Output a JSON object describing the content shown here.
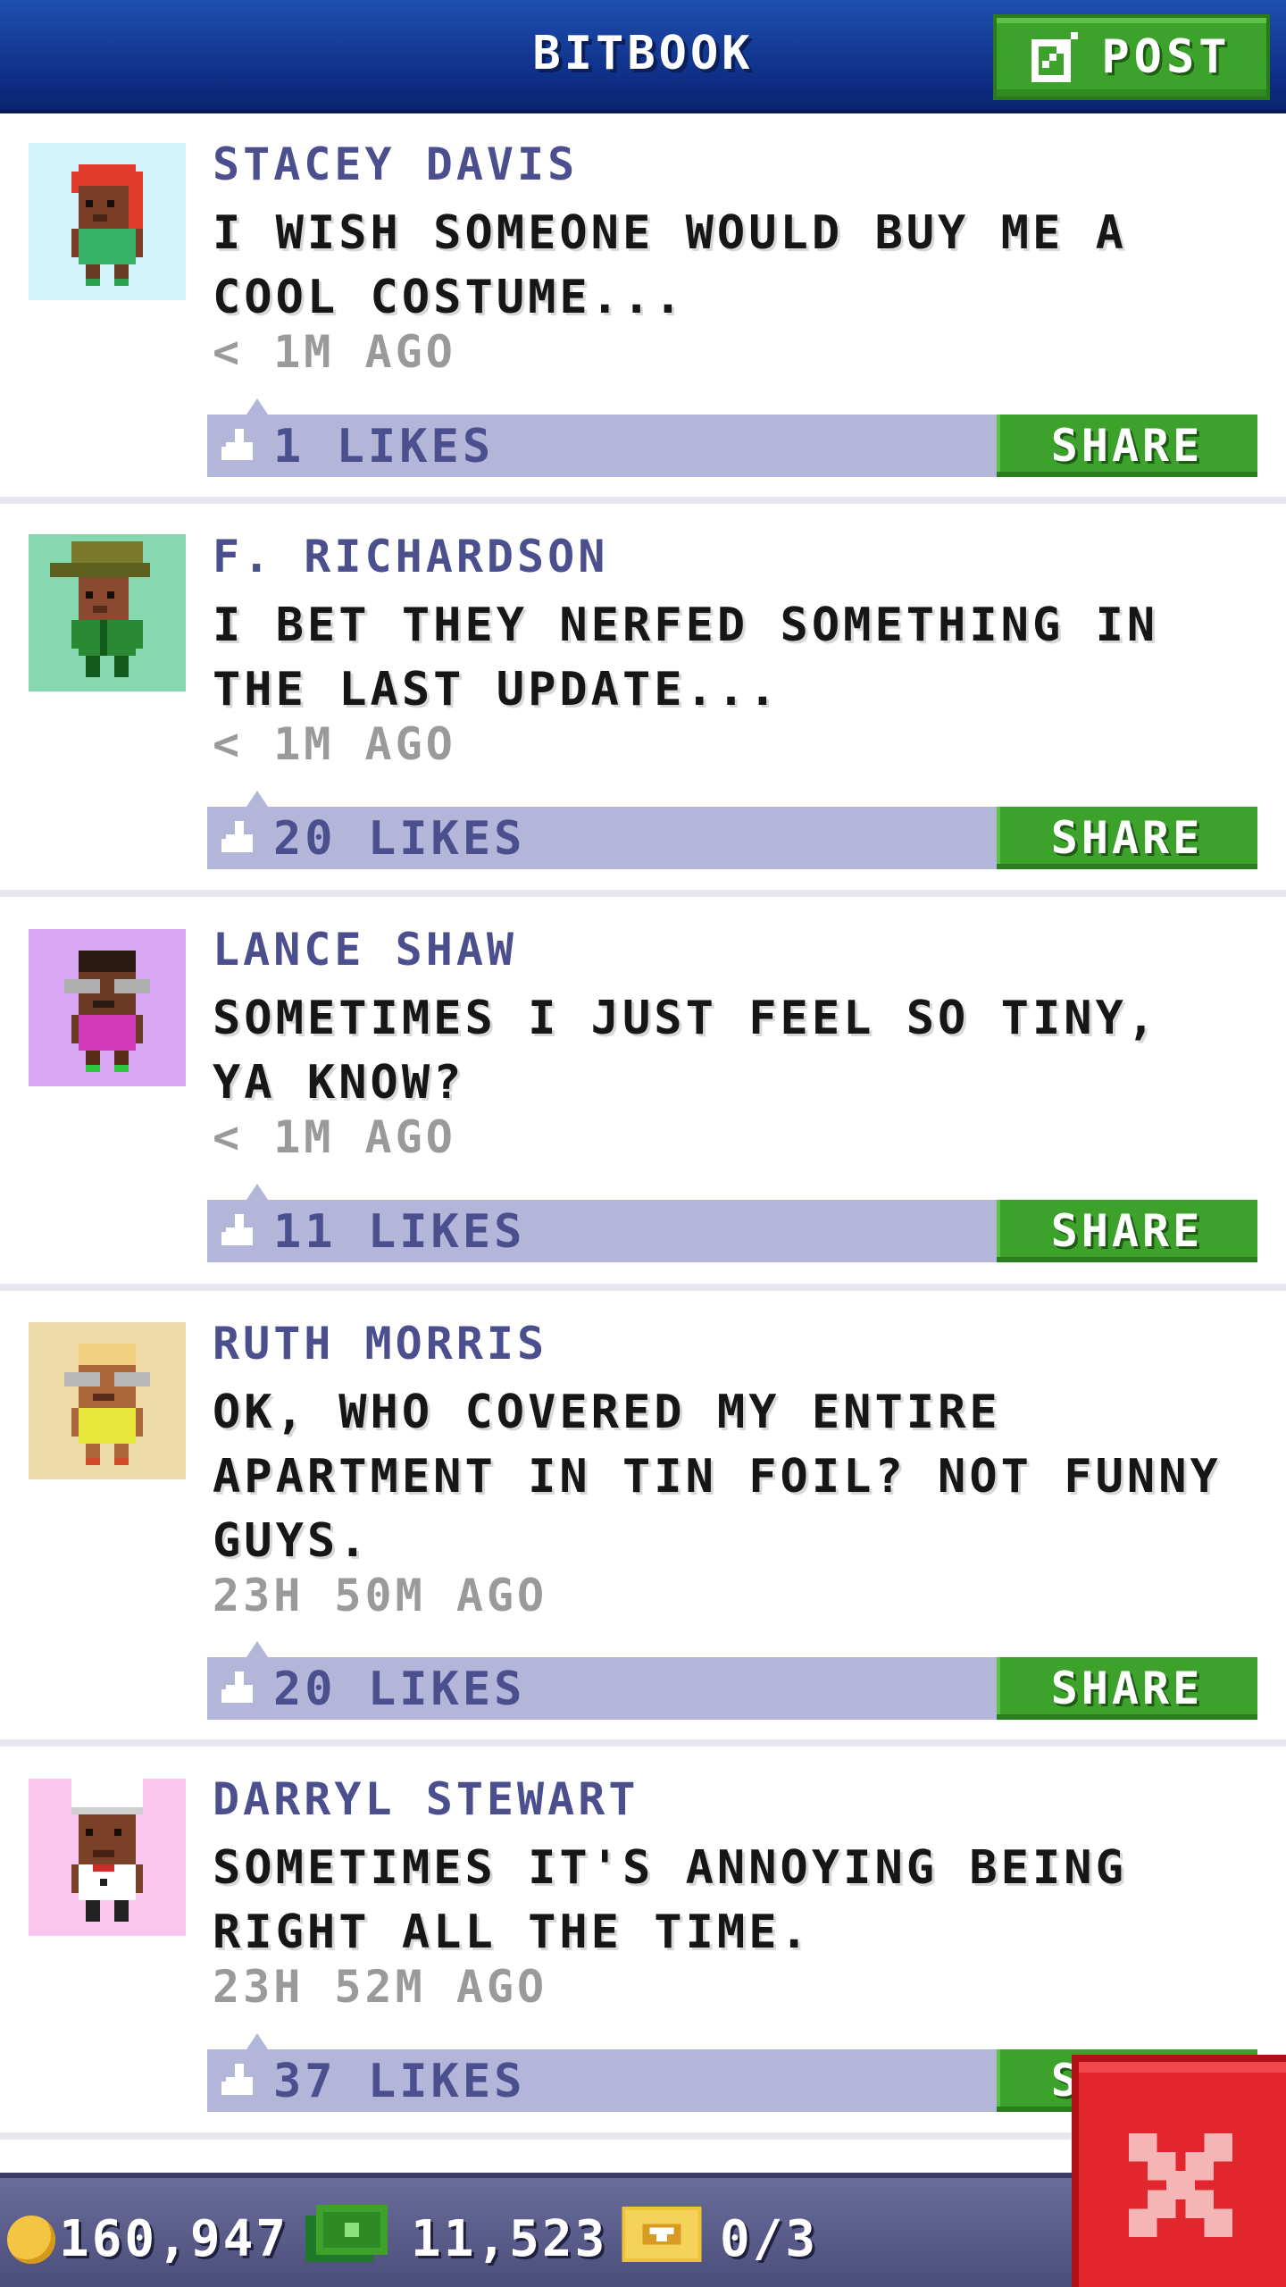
{
  "header": {
    "title": "BITBOOK",
    "post_label": "POST"
  },
  "posts": [
    {
      "author": "STACEY DAVIS",
      "message": "I WISH SOMEONE WOULD BUY ME A COOL COSTUME...",
      "time": "< 1M AGO",
      "likes": "1 LIKES",
      "share_label": "SHARE"
    },
    {
      "author": "F. RICHARDSON",
      "message": "I BET THEY NERFED SOMETHING IN THE LAST UPDATE...",
      "time": "< 1M AGO",
      "likes": "20 LIKES",
      "share_label": "SHARE"
    },
    {
      "author": "LANCE SHAW",
      "message": "SOMETIMES I JUST FEEL SO TINY, YA KNOW?",
      "time": "< 1M AGO",
      "likes": "11 LIKES",
      "share_label": "SHARE"
    },
    {
      "author": "RUTH MORRIS",
      "message": "OK, WHO COVERED MY ENTIRE APARTMENT IN TIN FOIL? NOT FUNNY GUYS.",
      "time": "23H 50M AGO",
      "likes": "20 LIKES",
      "share_label": "SHARE"
    },
    {
      "author": "DARRYL STEWART",
      "message": "SOMETIMES IT'S ANNOYING BEING RIGHT ALL THE TIME.",
      "time": "23H 52M AGO",
      "likes": "37 LIKES",
      "share_label": "SHARE"
    }
  ],
  "status_bar": {
    "coins": "160,947",
    "bux": "11,523",
    "tickets": "0/3"
  },
  "icons": {
    "post": "edit-icon",
    "like": "thumbs-up-icon",
    "coins": "coin-icon",
    "bux": "bux-icon",
    "tickets": "ticket-icon",
    "close": "close-icon"
  },
  "colors": {
    "header": "#0e2f86",
    "accent_green": "#3da22c",
    "like_bar": "#b3b6d9",
    "author": "#4b4f8e",
    "close_red": "#e2262d"
  }
}
